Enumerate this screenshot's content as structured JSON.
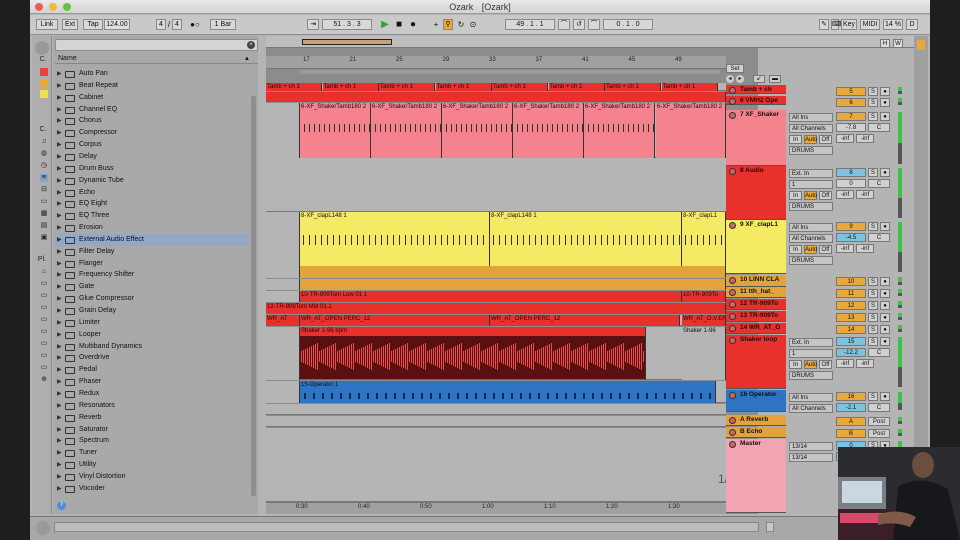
{
  "window": {
    "title": "Ozark",
    "title_suffix": "[Ozark]"
  },
  "toolbar": {
    "link": "Link",
    "ext": "Ext",
    "tap": "Tap",
    "tempo": "124.00",
    "sig_num": "4",
    "sig_den": "4",
    "quant": "1 Bar",
    "position": "51 .   3 .   3",
    "loop_start": "49 .   1 .   1",
    "loop_len": "0 .   1 .   0",
    "key": "Key",
    "midi": "MIDI",
    "cpu": "14 %",
    "disk": "D"
  },
  "browser": {
    "column": "Name",
    "selected": "External Audio Effect",
    "items": [
      "Auto Pan",
      "Beat Repeat",
      "Cabinet",
      "Channel EQ",
      "Chorus",
      "Compressor",
      "Corpus",
      "Delay",
      "Drum Buss",
      "Dynamic Tube",
      "Echo",
      "EQ Eight",
      "EQ Three",
      "Erosion",
      "External Audio Effect",
      "Filter Delay",
      "Flanger",
      "Frequency Shifter",
      "Gate",
      "Glue Compressor",
      "Grain Delay",
      "Limiter",
      "Looper",
      "Multiband Dynamics",
      "Overdrive",
      "Pedal",
      "Phaser",
      "Redux",
      "Resonators",
      "Reverb",
      "Saturator",
      "Spectrum",
      "Tuner",
      "Utility",
      "Vinyl Distortion",
      "Vocoder"
    ],
    "categories": [
      "C.",
      "C.",
      "Pl."
    ]
  },
  "ruler": {
    "bars": [
      "17",
      "21",
      "25",
      "29",
      "33",
      "37",
      "41",
      "45",
      "49"
    ],
    "times": [
      "0:30",
      "0:40",
      "0:50",
      "1:00",
      "1:10",
      "1:20",
      "1:30"
    ]
  },
  "set_label": "Set",
  "page_indicator": "1/1",
  "tracks": [
    {
      "name": "Tamb + ch",
      "clip": "Tamb + ch 1",
      "color": "#e8312d",
      "num": "5",
      "vol": "",
      "pan": "",
      "io1": "",
      "io2": ""
    },
    {
      "name": "6 VMH2 Ope",
      "clip": "",
      "color": "#e8312d",
      "num": "6",
      "vol": "",
      "pan": "",
      "io1": "",
      "io2": ""
    },
    {
      "name": "7 XF_Shaker",
      "clip": "6-XF_ShakerTamb180 2",
      "color": "#f4838e",
      "num": "7",
      "vol": "-7.8",
      "pan": "C",
      "io1": "All Ins",
      "io2": "All Channels",
      "monitor": [
        "In",
        "Auto",
        "Off"
      ],
      "send1": "-inf",
      "send2": "-inf",
      "group": "DRUMS"
    },
    {
      "name": "8 Audio",
      "clip": "",
      "color": "#e8312d",
      "num": "8",
      "vol": "0",
      "pan": "C",
      "io1": "Ext. In",
      "io2": "1",
      "monitor": [
        "In",
        "Auto",
        "Off"
      ],
      "send1": "-inf",
      "send2": "-inf",
      "group": "DRUMS"
    },
    {
      "name": "9 XF_clapL1",
      "clip": "8-XF_clapL148 1",
      "color": "#f5ea63",
      "num": "9",
      "vol": "-4.5",
      "pan": "C",
      "io1": "All Ins",
      "io2": "All Channels",
      "monitor": [
        "In",
        "Auto",
        "Off"
      ],
      "send1": "-inf",
      "send2": "-inf",
      "group": "DRUMS"
    },
    {
      "name": "10 LINN CLA",
      "clip": "",
      "color": "#e2a43a",
      "num": "10",
      "vol": "",
      "pan": ""
    },
    {
      "name": "11 tth_hat_",
      "clip": "",
      "color": "#e2a43a",
      "num": "11",
      "vol": "",
      "pan": ""
    },
    {
      "name": "12 TR-909To",
      "clip": "10-TR-909Tom Low 01 1",
      "color": "#e8312d",
      "num": "12",
      "vol": "",
      "pan": ""
    },
    {
      "name": "13 TR-909To",
      "clip": "12-TR-909Tom Mid 01 1",
      "color": "#e8312d",
      "num": "13",
      "vol": "",
      "pan": ""
    },
    {
      "name": "14 WR_AT_O",
      "clip": "WR_AT_OPEN PERC_12",
      "color": "#e8312d",
      "num": "14",
      "vol": "",
      "pan": ""
    },
    {
      "name": "Shaker loop",
      "clip": "Shaker 1-96 bpm",
      "color": "#e8312d",
      "num": "15",
      "vol": "-12.2",
      "pan": "C",
      "io1": "Ext. In",
      "io2": "1",
      "monitor": [
        "In",
        "Auto",
        "Off"
      ],
      "send1": "-inf",
      "send2": "-inf",
      "group": "DRUMS"
    },
    {
      "name": "16 Operator",
      "clip": "15-Operator 1",
      "color": "#2f74c2",
      "num": "16",
      "vol": "-2.1",
      "pan": "C",
      "io1": "All Ins",
      "io2": "All Channels"
    },
    {
      "name": "A Reverb",
      "color": "#e2a43a",
      "num": "A",
      "pan": "Post"
    },
    {
      "name": "B Echo",
      "color": "#e2a43a",
      "num": "B",
      "pan": "Post"
    },
    {
      "name": "Master",
      "color": "#f4a3b2",
      "num": "0",
      "vol": "-3.9",
      "io1": "13/14",
      "io2": "13/14"
    }
  ],
  "clips_extra": {
    "clap_mid": "8-XF_clapL148 1",
    "clap_end": "8-XF_clapL1",
    "tom_end": "10-TR-909To",
    "shaker_end": "Shaker 1-96",
    "wr_mid": "WR_AT_OPEN PERC_12",
    "wr_end": "WR_AT_O.V.ER",
    "wr_start": "WR_AT"
  }
}
